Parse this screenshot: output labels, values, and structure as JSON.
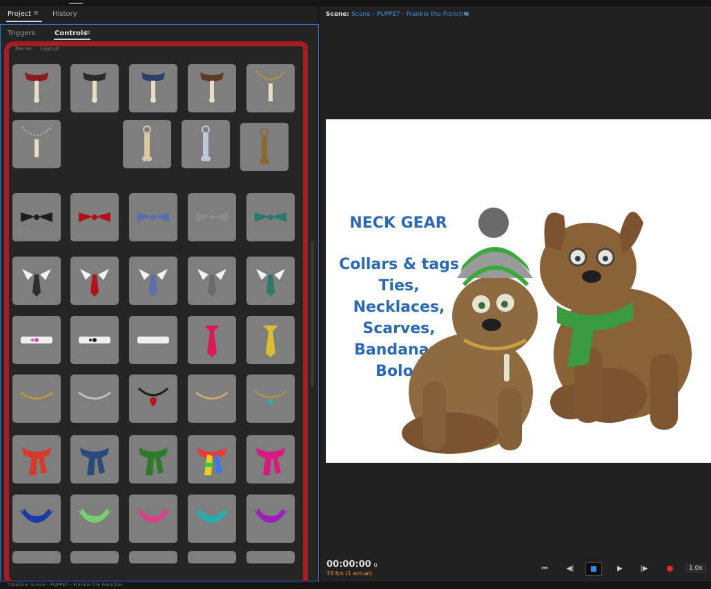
{
  "panel_tabs": {
    "project": "Project",
    "history": "History"
  },
  "sub_tabs": {
    "triggers": "Triggers",
    "controls": "Controls"
  },
  "inner_tabs": {
    "first": "Name",
    "second": "Layout"
  },
  "scene": {
    "label": "Scene:",
    "name": "Scene - PUPPET - Frankie the Frenchie"
  },
  "stage_text": {
    "heading": "NECK GEAR",
    "lines": [
      "Collars & tags",
      "Ties,",
      "Necklaces,",
      "Scarves,",
      "Bandanas.",
      "Bolos"
    ]
  },
  "transport": {
    "timecode": "00:00:00",
    "frame": "0",
    "fps": "33 fps (1 actual)",
    "speed": "1.0x",
    "buttons": [
      "⏮",
      "◀|",
      "■",
      "▶",
      "|▶",
      "●"
    ]
  },
  "bottom_bar": {
    "text": "Timeline: Scene - PUPPET - Frankie the Frenchie"
  },
  "colors": {
    "accent_blue": "#2d8ceb",
    "record_red": "#e0282a",
    "highlight_red": "#a61d24",
    "stage_text": "#2a6ab5"
  },
  "controls_grid": [
    {
      "kind": "collar-tag",
      "color": "#8c1a1f"
    },
    {
      "kind": "collar-tag",
      "color": "#2b2b2b"
    },
    {
      "kind": "collar-tag",
      "color": "#2a4068"
    },
    {
      "kind": "collar-tag",
      "color": "#5c3b22"
    },
    {
      "kind": "chain-tag",
      "color": "#b79a3a"
    },
    {
      "kind": "chain-tag",
      "color": "#a0a0a0"
    },
    {
      "kind": "empty",
      "color": ""
    },
    {
      "kind": "bone-ring",
      "color": "#d8c8a4"
    },
    {
      "kind": "bone-ring",
      "color": "#c0c8d8"
    },
    {
      "kind": "bone-ring",
      "color": "#8a6a30"
    },
    {
      "kind": "bowtie",
      "color": "#1e1e1e"
    },
    {
      "kind": "bowtie",
      "color": "#b0121a"
    },
    {
      "kind": "bowtie",
      "color": "#5a6fae"
    },
    {
      "kind": "bowtie",
      "color": "#8a8a8a"
    },
    {
      "kind": "bowtie",
      "color": "#2d7a6a"
    },
    {
      "kind": "tie",
      "color": "#2e2e2e"
    },
    {
      "kind": "tie",
      "color": "#b0121a"
    },
    {
      "kind": "tie",
      "color": "#5a6fae"
    },
    {
      "kind": "tie",
      "color": "#6a6a6a"
    },
    {
      "kind": "tie",
      "color": "#2d7a6a"
    },
    {
      "kind": "band",
      "color": "#e04aa0"
    },
    {
      "kind": "band",
      "color": "#1e1e1e"
    },
    {
      "kind": "band",
      "color": "#f0f0f0"
    },
    {
      "kind": "long-tie",
      "color": "#d81a55"
    },
    {
      "kind": "long-tie",
      "color": "#d8c030"
    },
    {
      "kind": "necklace",
      "color": "#b79a3a"
    },
    {
      "kind": "necklace",
      "color": "#c0c0c0"
    },
    {
      "kind": "heart-pendant",
      "color": "#c0121a"
    },
    {
      "kind": "necklace",
      "color": "#c8a870"
    },
    {
      "kind": "gem-pendant",
      "color": "#2bb0a8"
    },
    {
      "kind": "scarf",
      "color": "#d83a2a"
    },
    {
      "kind": "scarf",
      "color": "#2a4a78"
    },
    {
      "kind": "scarf",
      "color": "#2a7a2a"
    },
    {
      "kind": "scarf-rainbow",
      "color": "#e8d020"
    },
    {
      "kind": "scarf",
      "color": "#d81a80"
    },
    {
      "kind": "bandana",
      "color": "#1a3aa8"
    },
    {
      "kind": "bandana",
      "color": "#7ad070"
    },
    {
      "kind": "bandana",
      "color": "#d8408a"
    },
    {
      "kind": "bandana",
      "color": "#20b0b0"
    },
    {
      "kind": "bandana",
      "color": "#9a20b8"
    },
    {
      "kind": "partial",
      "color": ""
    },
    {
      "kind": "partial",
      "color": ""
    },
    {
      "kind": "partial",
      "color": ""
    },
    {
      "kind": "partial",
      "color": ""
    },
    {
      "kind": "partial",
      "color": ""
    }
  ]
}
